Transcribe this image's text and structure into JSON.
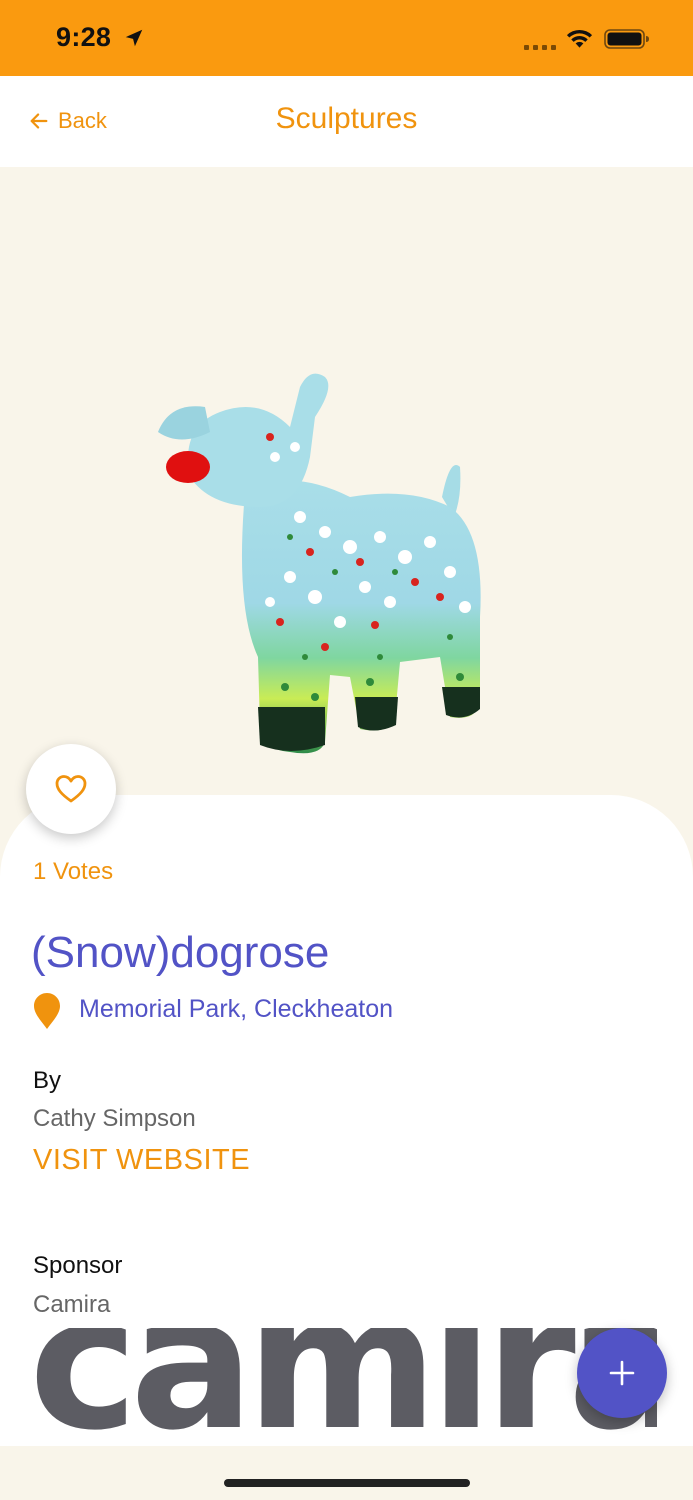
{
  "status_bar": {
    "time": "9:28",
    "background_color": "#FA9A0F",
    "icons": [
      "location-arrow-icon",
      "cellular-signal-icon",
      "wifi-icon",
      "battery-icon"
    ]
  },
  "nav": {
    "back_label": "Back",
    "title": "Sculptures",
    "accent_color": "#F0930E",
    "back_icon": "arrow-left-icon"
  },
  "sculpture": {
    "image": "painted-dog-sculpture",
    "votes": "1 Votes",
    "title": "(Snow)dogrose",
    "location": "Memorial Park, Cleckheaton",
    "by_label": "By",
    "artist": "Cathy Simpson",
    "website_label": "VISIT WEBSITE",
    "sponsor_label": "Sponsor",
    "sponsor_name": "Camira",
    "sponsor_logo_text": "camira",
    "title_color": "#5253C6"
  },
  "actions": {
    "favorite_icon": "heart-icon",
    "add_icon": "plus-icon",
    "fab_color": "#5253C6"
  }
}
